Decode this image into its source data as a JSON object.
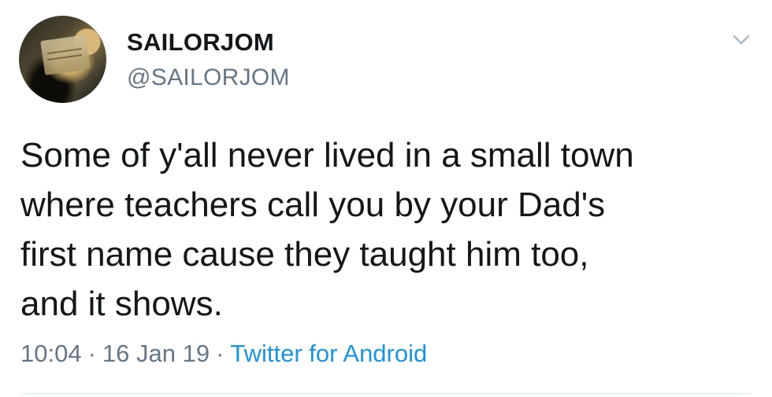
{
  "tweet": {
    "author": {
      "display_name": "SAILORJOM",
      "handle": "@SAILORJOM"
    },
    "text": "Some of y'all never lived in a small town\nwhere teachers call you by your Dad's\nfirst name cause they taught him too,\nand it shows.",
    "time": "10:04",
    "separator": "·",
    "date": "16 Jan 19",
    "source": "Twitter for Android"
  },
  "icons": {
    "menu": "chevron-down-icon",
    "avatar": "avatar-image"
  },
  "colors": {
    "text": "#14171a",
    "secondary": "#657786",
    "link": "#1b95e0",
    "divider": "#e1e8ed"
  }
}
